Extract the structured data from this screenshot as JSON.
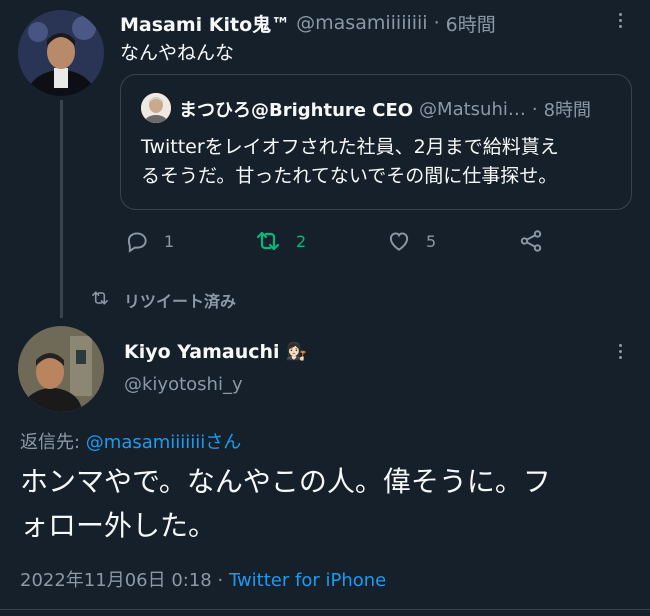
{
  "tweet1": {
    "author_name": "Masami Kito鬼™",
    "handle": "@masamiiiiiiii",
    "dot": "·",
    "time": "6時間",
    "text": "なんやねんな",
    "quote": {
      "author_name": "まつひろ@Brighture CEO",
      "handle": "@Matsuhi…",
      "dot": "·",
      "time": "8時間",
      "text_line1": "Twitterをレイオフされた社員、2月まで給料貰え",
      "text_line2": "るそうだ。甘ったれてないでその間に仕事探せ。"
    },
    "actions": {
      "reply_count": "1",
      "retweet_count": "2",
      "like_count": "5"
    },
    "colors": {
      "retweet_active": "#00ba7c"
    }
  },
  "retweet_notice": "リツイート済み",
  "tweet2": {
    "author_name": "Kiyo Yamauchi",
    "emoji": "👩🏻‍⚖️",
    "handle": "@kiyotoshi_y",
    "reply_to_prefix": "返信先: ",
    "reply_to_handle": "@masamiiiiiiiさん",
    "text_line1": "ホンマやで。なんやこの人。偉そうに。フ",
    "text_line2": "ォロー外した。",
    "timestamp": "2022年11月06日 0:18 · ",
    "source": "Twitter for iPhone"
  }
}
